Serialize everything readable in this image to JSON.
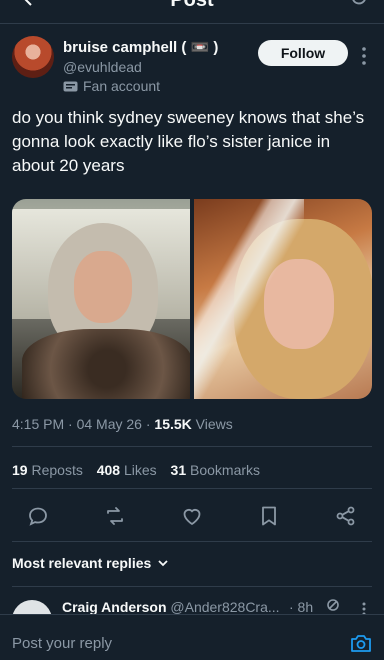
{
  "header": {
    "title": "Post"
  },
  "post": {
    "author_name": "bruise camphell ( 📼 )",
    "author_handle": "@evuhldead",
    "author_label": "Fan account",
    "follow_label": "Follow",
    "text": "do you think sydney sweeney knows that she’s gonna look exactly like flo’s sister janice in about 20 years",
    "time": "4:15 PM",
    "date": "04 May 26",
    "views_count": "15.5K",
    "views_label": "Views",
    "reposts_count": "19",
    "reposts_label": "Reposts",
    "likes_count": "408",
    "likes_label": "Likes",
    "bookmarks_count": "31",
    "bookmarks_label": "Bookmarks"
  },
  "replies": {
    "sort_label": "Most relevant replies",
    "first": {
      "name": "Craig Anderson",
      "handle": "@Ander828Cra...",
      "time": "· 8h"
    }
  },
  "composer": {
    "placeholder": "Post your reply"
  },
  "colors": {
    "background": "#15202b",
    "text": "#f7f9f9",
    "muted": "#8b98a5",
    "accent": "#1d9bf0"
  },
  "icons": [
    "back-arrow-icon",
    "refresh-icon",
    "fan-badge-icon",
    "more-icon",
    "reply-icon",
    "repost-icon",
    "like-icon",
    "bookmark-icon",
    "share-icon",
    "chevron-down-icon",
    "camera-icon"
  ]
}
